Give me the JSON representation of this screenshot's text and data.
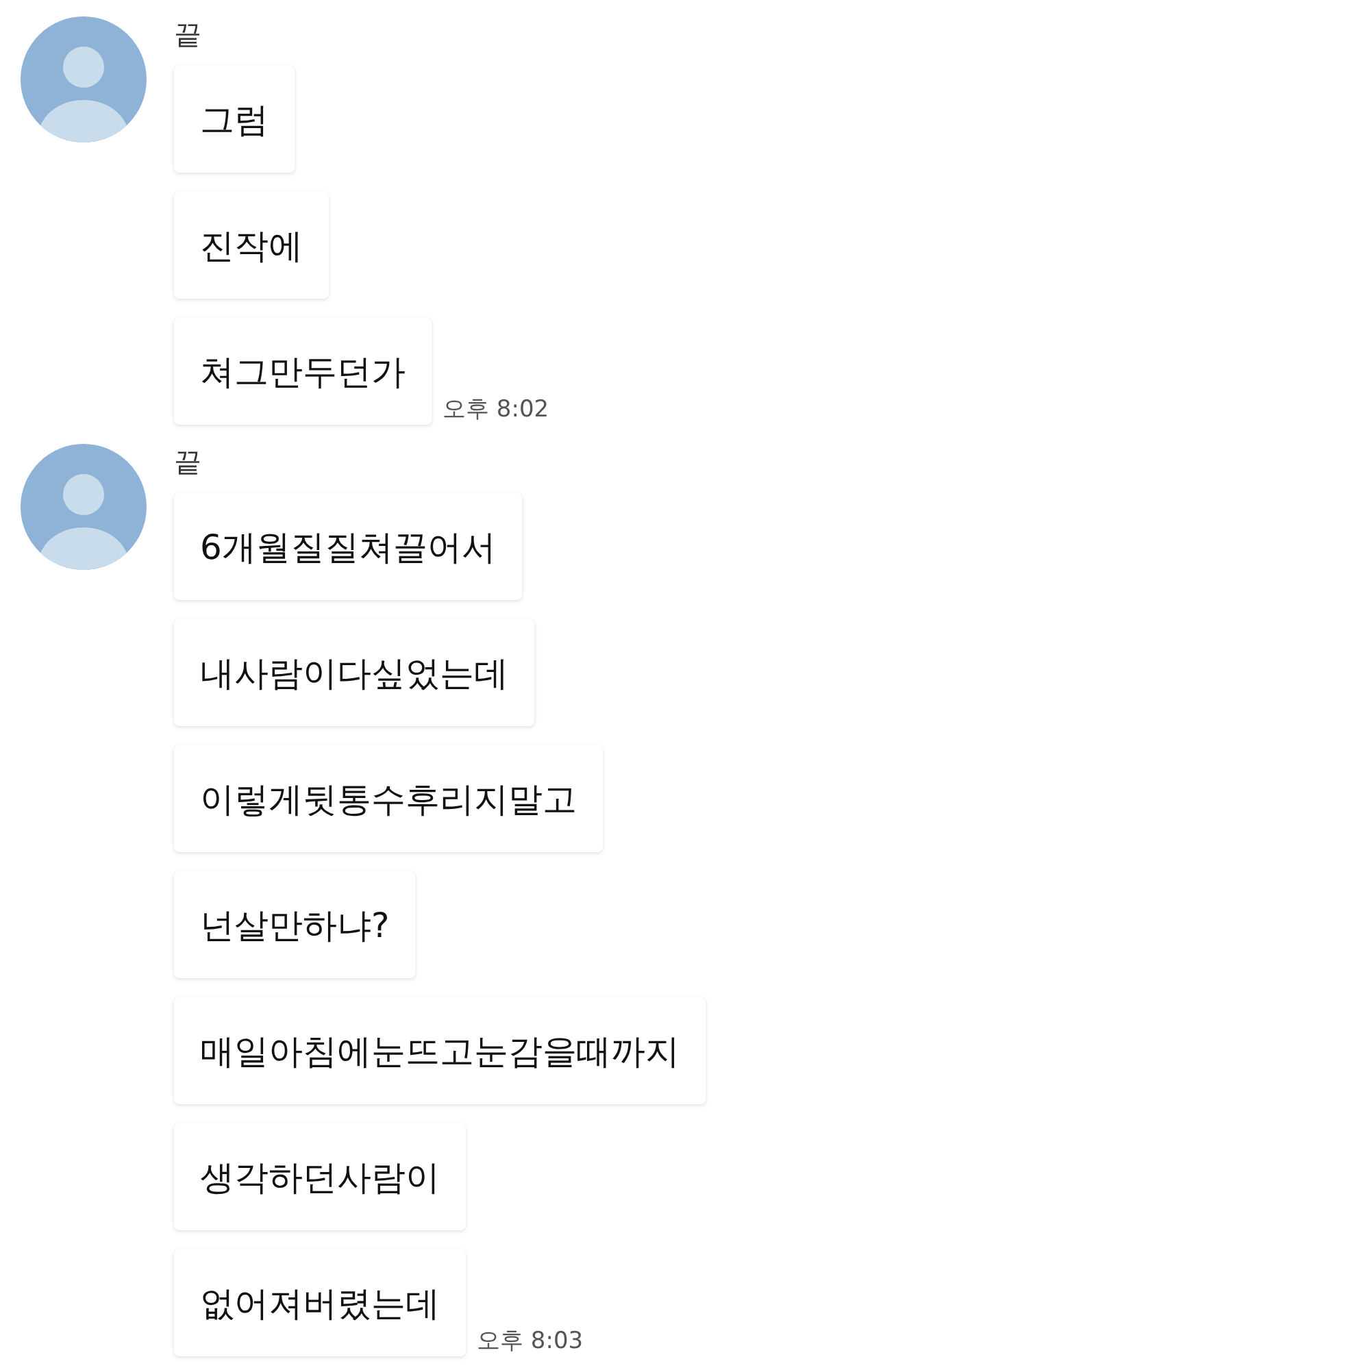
{
  "groups": [
    {
      "sender": "끝",
      "messages": [
        "그럼",
        "진작에",
        "쳐그만두던가"
      ],
      "time": "오후 8:02"
    },
    {
      "sender": "끝",
      "messages": [
        "6개월질질쳐끌어서",
        "내사람이다싶었는데",
        "이렇게뒷통수후리지말고",
        "넌살만하냐?",
        "매일아침에눈뜨고눈감을때까지",
        "생각하던사람이",
        "없어져버렸는데"
      ],
      "time": "오후 8:03"
    }
  ]
}
